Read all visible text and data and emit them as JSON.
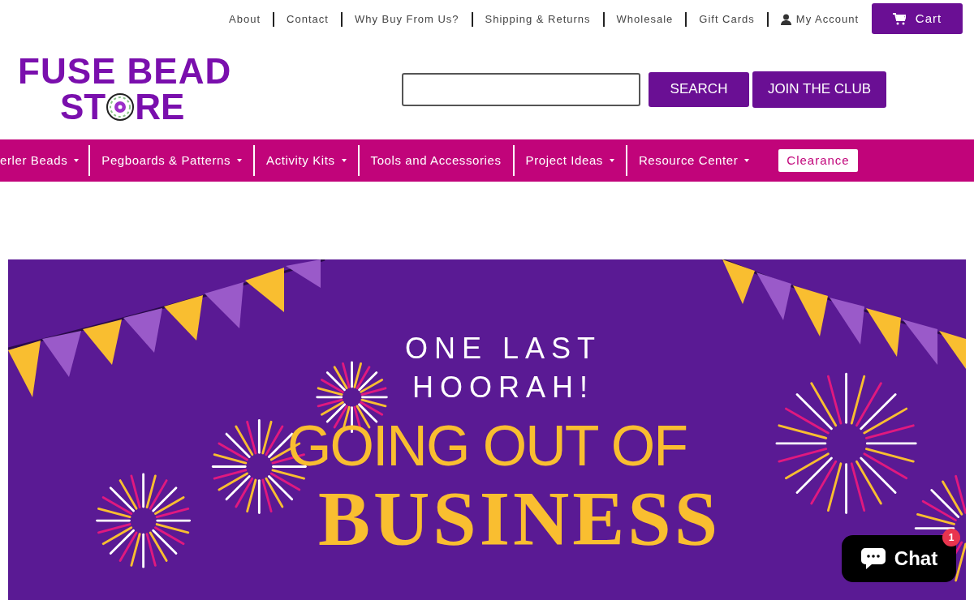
{
  "top_links": [
    {
      "label": "About",
      "kind": "link"
    },
    {
      "label": "Contact",
      "kind": "link"
    },
    {
      "label": "Why Buy From Us?",
      "kind": "link"
    },
    {
      "label": "Shipping & Returns",
      "kind": "link"
    },
    {
      "label": "Wholesale",
      "kind": "link"
    },
    {
      "label": "Gift Cards",
      "kind": "link"
    },
    {
      "label": "My Account",
      "kind": "account"
    }
  ],
  "cart_button": "Cart",
  "logo": {
    "line_1": "FUSE BEAD",
    "line_2_start": "ST",
    "line_2_end": "RE"
  },
  "search": {
    "button": "SEARCH"
  },
  "join_button": "JOIN THE CLUB",
  "nav": [
    {
      "label": "erler Beads",
      "dropdown": true,
      "highlighted": false
    },
    {
      "label": "Pegboards & Patterns",
      "dropdown": true,
      "highlighted": false
    },
    {
      "label": "Activity Kits",
      "dropdown": true,
      "highlighted": false
    },
    {
      "label": "Tools and Accessories",
      "dropdown": false,
      "highlighted": false
    },
    {
      "label": "Project Ideas",
      "dropdown": true,
      "highlighted": false
    },
    {
      "label": "Resource Center",
      "dropdown": true,
      "highlighted": false
    },
    {
      "label": "Clearance",
      "dropdown": false,
      "highlighted": true
    }
  ],
  "banner": {
    "line_1": "ONE LAST",
    "line_2": "HOORAH!",
    "headline_1": "GOING OUT OF",
    "headline_2": "BUSINESS"
  },
  "chat": {
    "label": "Chat",
    "badge": "1"
  }
}
